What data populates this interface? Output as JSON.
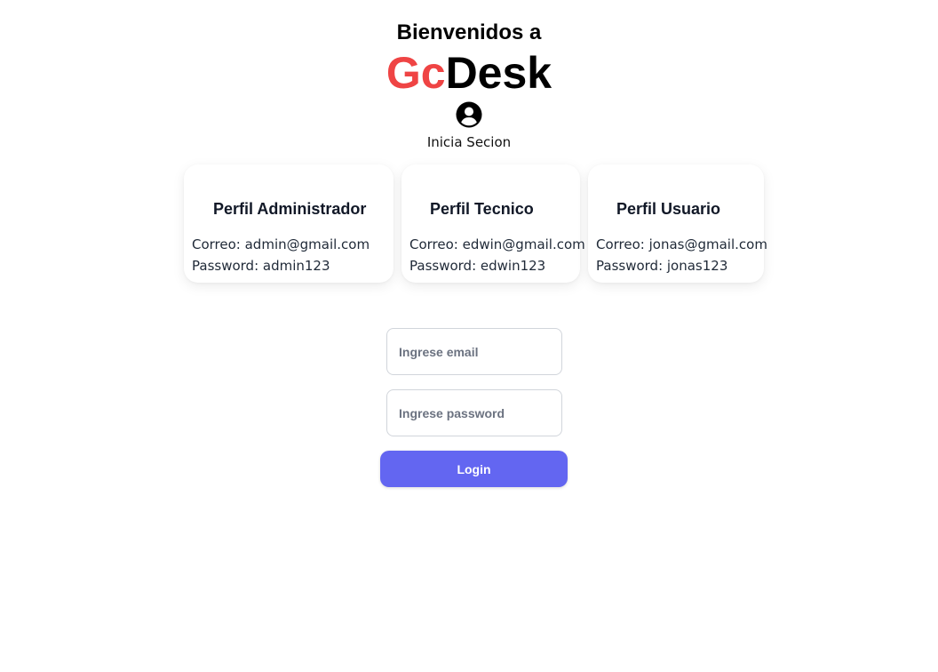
{
  "header": {
    "welcome": "Bienvenidos a",
    "brand_part1": "Gc",
    "brand_part2": "Desk",
    "icon": "user-circle-icon",
    "subtitle": "Inicia Secion"
  },
  "colors": {
    "brand_red": "#ef4444",
    "brand_dark": "#000000",
    "button": "#6366f1"
  },
  "profiles": [
    {
      "title": "Perfil Administrador",
      "email_line": "Correo: admin@gmail.com",
      "password_line": "Password: admin123"
    },
    {
      "title": "Perfil Tecnico",
      "email_line": "Correo: edwin@gmail.com",
      "password_line": "Password: edwin123"
    },
    {
      "title": "Perfil Usuario",
      "email_line": "Correo: jonas@gmail.com",
      "password_line": "Password: jonas123"
    }
  ],
  "form": {
    "email_placeholder": "Ingrese email",
    "email_value": "",
    "password_placeholder": "Ingrese password",
    "password_value": "",
    "login_label": "Login"
  }
}
